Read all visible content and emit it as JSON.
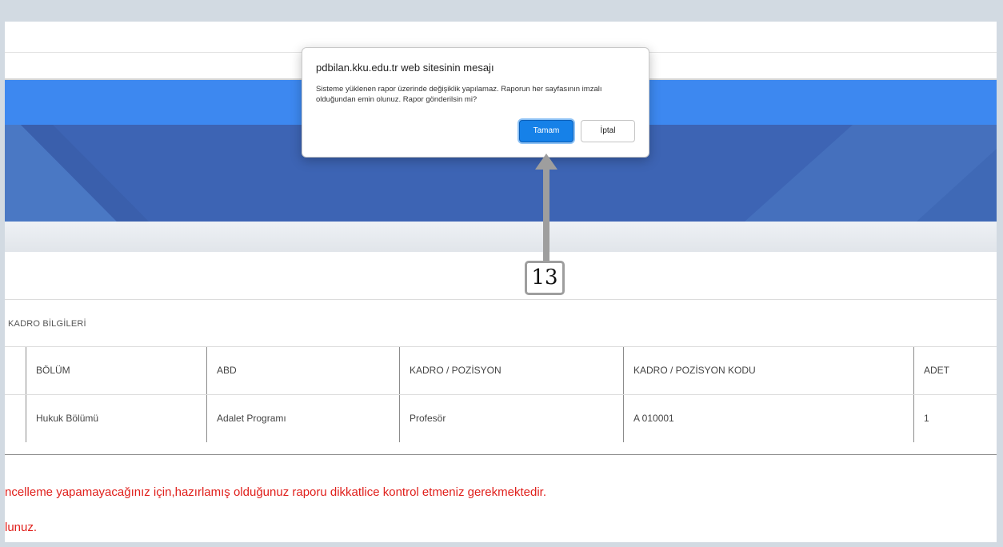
{
  "dialog": {
    "title": "pdbilan.kku.edu.tr web sitesinin mesajı",
    "message": "Sisteme yüklenen rapor üzerinde değişiklik yapılamaz. Raporun her sayfasının imzalı olduğundan emin olunuz. Rapor gönderilsin mi?",
    "ok_label": "Tamam",
    "cancel_label": "İptal"
  },
  "callout": {
    "number": "13"
  },
  "section": {
    "title": "KADRO BİLGİLERİ"
  },
  "table": {
    "headers": [
      "BÖLÜM",
      "ABD",
      "KADRO / POZİSYON",
      "KADRO / POZİSYON KODU",
      "ADET"
    ],
    "rows": [
      [
        "Hukuk Bölümü",
        "Adalet Programı",
        "Profesör",
        "A 010001",
        "1"
      ]
    ]
  },
  "notices": [
    "ncelleme yapamayacağınız için,hazırlamış olduğunuz raporu dikkatlice kontrol etmeniz gerekmektedir.",
    "lunuz."
  ],
  "colors": {
    "banner_blue": "#3d88f0",
    "hero_blue": "#3d64b4",
    "primary_button": "#1681e8",
    "warning_text": "#e0201c"
  }
}
